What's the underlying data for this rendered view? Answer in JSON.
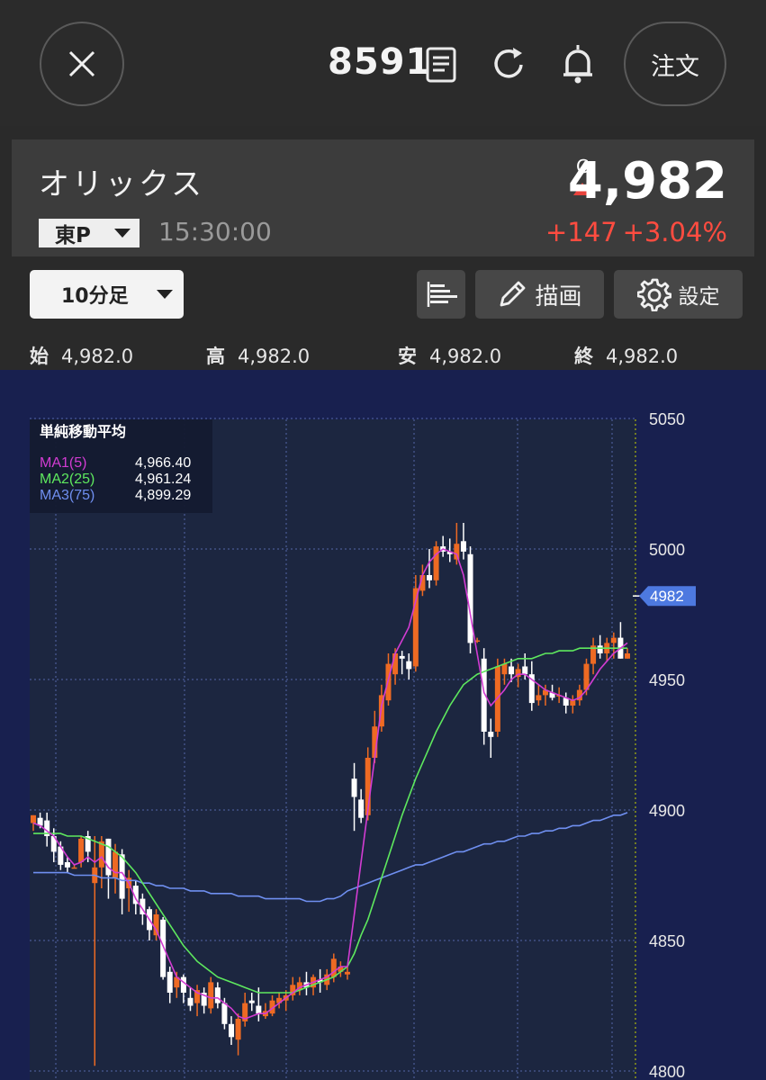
{
  "header": {
    "code": "8591",
    "order_label": "注文",
    "icons": [
      "close-icon",
      "document-icon",
      "reload-icon",
      "bell-icon"
    ]
  },
  "stock": {
    "name": "オリックス",
    "market": "東P",
    "time": "15:30:00",
    "price_flag": "C",
    "price": "4,982",
    "change": "+147",
    "change_pct": "+3.04%",
    "up_color": "#ff4c40"
  },
  "toolbar": {
    "timeframe": "10分足",
    "draw_label": "描画",
    "settings_label": "設定"
  },
  "ohlc": {
    "open_label": "始",
    "open": "4,982.0",
    "high_label": "高",
    "high": "4,982.0",
    "low_label": "安",
    "low": "4,982.0",
    "close_label": "終",
    "close": "4,982.0"
  },
  "chart_data": {
    "type": "candlestick",
    "panel_title": "単純移動平均",
    "y_ticks": [
      5050,
      5000,
      4950,
      4900,
      4850,
      4800
    ],
    "ylim": [
      4800,
      5050
    ],
    "current_price_label": "4982",
    "current_price": 4982,
    "ma_legend": [
      {
        "name": "MA1(5)",
        "value": "4,966.40",
        "color": "#d23cd2"
      },
      {
        "name": "MA2(25)",
        "value": "4,961.24",
        "color": "#5ee85e"
      },
      {
        "name": "MA3(75)",
        "value": "4,899.29",
        "color": "#6f8ff0"
      }
    ],
    "candles": [
      [
        4895,
        4898,
        4892,
        4898
      ],
      [
        4897,
        4899,
        4893,
        4894
      ],
      [
        4896,
        4899,
        4886,
        4890
      ],
      [
        4890,
        4893,
        4880,
        4884
      ],
      [
        4886,
        4888,
        4877,
        4879
      ],
      [
        4880,
        4882,
        4876,
        4878
      ],
      [
        4878,
        4879,
        4878,
        4878
      ],
      [
        4880,
        4890,
        4878,
        4889
      ],
      [
        4890,
        4892,
        4880,
        4884
      ],
      [
        4872,
        4890,
        4802,
        4878
      ],
      [
        4878,
        4890,
        4870,
        4888
      ],
      [
        4889,
        4889,
        4866,
        4875
      ],
      [
        4874,
        4887,
        4868,
        4884
      ],
      [
        4883,
        4885,
        4860,
        4866
      ],
      [
        4870,
        4877,
        4861,
        4874
      ],
      [
        4871,
        4873,
        4860,
        4864
      ],
      [
        4866,
        4868,
        4856,
        4860
      ],
      [
        4862,
        4863,
        4850,
        4854
      ],
      [
        4852,
        4862,
        4850,
        4860
      ],
      [
        4858,
        4859,
        4835,
        4836
      ],
      [
        4838,
        4840,
        4826,
        4830
      ],
      [
        4832,
        4838,
        4828,
        4836
      ],
      [
        4836,
        4837,
        4826,
        4830
      ],
      [
        4828,
        4832,
        4823,
        4825
      ],
      [
        4826,
        4833,
        4821,
        4831
      ],
      [
        4830,
        4832,
        4822,
        4825
      ],
      [
        4824,
        4836,
        4822,
        4834
      ],
      [
        4832,
        4834,
        4824,
        4826
      ],
      [
        4826,
        4828,
        4816,
        4818
      ],
      [
        4818,
        4821,
        4810,
        4813
      ],
      [
        4812,
        4822,
        4806,
        4820
      ],
      [
        4819,
        4830,
        4817,
        4826
      ],
      [
        4827,
        4830,
        4823,
        4826
      ],
      [
        4825,
        4832,
        4819,
        4822
      ],
      [
        4821,
        4826,
        4820,
        4823
      ],
      [
        4822,
        4829,
        4821,
        4827
      ],
      [
        4826,
        4830,
        4824,
        4828
      ],
      [
        4827,
        4831,
        4823,
        4829
      ],
      [
        4829,
        4836,
        4827,
        4833
      ],
      [
        4831,
        4836,
        4829,
        4834
      ],
      [
        4834,
        4838,
        4829,
        4832
      ],
      [
        4832,
        4837,
        4829,
        4836
      ],
      [
        4835,
        4839,
        4830,
        4834
      ],
      [
        4833,
        4839,
        4831,
        4837
      ],
      [
        4836,
        4845,
        4834,
        4843
      ],
      [
        4838,
        4842,
        4836,
        4840
      ],
      [
        4837,
        4840,
        4835,
        4838
      ],
      [
        4912,
        4918,
        4892,
        4905
      ],
      [
        4904,
        4908,
        4895,
        4897
      ],
      [
        4898,
        4924,
        4896,
        4920
      ],
      [
        4920,
        4938,
        4918,
        4932
      ],
      [
        4932,
        4948,
        4930,
        4944
      ],
      [
        4942,
        4960,
        4940,
        4956
      ],
      [
        4952,
        4962,
        4948,
        4960
      ],
      [
        4959,
        4961,
        4952,
        4958
      ],
      [
        4957,
        4960,
        4950,
        4954
      ],
      [
        4955,
        4990,
        4953,
        4985
      ],
      [
        4984,
        4994,
        4982,
        4990
      ],
      [
        4990,
        5000,
        4985,
        4988
      ],
      [
        4988,
        5003,
        4986,
        5001
      ],
      [
        5001,
        5005,
        4997,
        4999
      ],
      [
        4999,
        5004,
        4995,
        4998
      ],
      [
        4996,
        5010,
        4994,
        5002
      ],
      [
        5003,
        5010,
        4996,
        4999
      ],
      [
        4998,
        5001,
        4960,
        4964
      ],
      [
        4965,
        4966,
        4964,
        4965
      ],
      [
        4958,
        4962,
        4925,
        4930
      ],
      [
        4930,
        4935,
        4920,
        4928
      ],
      [
        4930,
        4958,
        4928,
        4955
      ],
      [
        4952,
        4958,
        4948,
        4956
      ],
      [
        4955,
        4958,
        4949,
        4952
      ],
      [
        4951,
        4956,
        4947,
        4954
      ],
      [
        4955,
        4960,
        4950,
        4952
      ],
      [
        4952,
        4957,
        4938,
        4941
      ],
      [
        4942,
        4948,
        4940,
        4944
      ],
      [
        4944,
        4948,
        4940,
        4946
      ],
      [
        4945,
        4948,
        4942,
        4943
      ],
      [
        4944,
        4947,
        4941,
        4944
      ],
      [
        4943,
        4945,
        4937,
        4940
      ],
      [
        4940,
        4944,
        4937,
        4942
      ],
      [
        4942,
        4948,
        4940,
        4946
      ],
      [
        4946,
        4958,
        4944,
        4956
      ],
      [
        4956,
        4966,
        4952,
        4963
      ],
      [
        4963,
        4967,
        4958,
        4960
      ],
      [
        4960,
        4966,
        4957,
        4964
      ],
      [
        4964,
        4968,
        4958,
        4966
      ],
      [
        4966,
        4972,
        4958,
        4958
      ],
      [
        4958,
        4962,
        4958,
        4960
      ]
    ],
    "ma1": [
      4895,
      4894,
      4892,
      4890,
      4886,
      4882,
      4879,
      4880,
      4882,
      4880,
      4882,
      4878,
      4876,
      4876,
      4872,
      4866,
      4862,
      4858,
      4854,
      4848,
      4842,
      4836,
      4834,
      4832,
      4830,
      4829,
      4828,
      4828,
      4826,
      4824,
      4821,
      4820,
      4821,
      4822,
      4822,
      4824,
      4826,
      4828,
      4830,
      4832,
      4833,
      4834,
      4835,
      4836,
      4838,
      4840,
      4840,
      4860,
      4880,
      4900,
      4920,
      4940,
      4950,
      4960,
      4965,
      4970,
      4980,
      4990,
      4995,
      4998,
      5000,
      4999,
      4998,
      4990,
      4975,
      4960,
      4945,
      4940,
      4943,
      4946,
      4950,
      4952,
      4952,
      4950,
      4948,
      4946,
      4945,
      4944,
      4943,
      4942,
      4943,
      4946,
      4950,
      4954,
      4957,
      4960,
      4962,
      4964
    ],
    "ma2": [
      4891,
      4891,
      4891,
      4891,
      4891,
      4890,
      4890,
      4890,
      4889,
      4888,
      4887,
      4886,
      4884,
      4882,
      4879,
      4876,
      4872,
      4868,
      4864,
      4860,
      4856,
      4852,
      4848,
      4845,
      4842,
      4840,
      4838,
      4836,
      4835,
      4834,
      4833,
      4832,
      4831,
      4830,
      4830,
      4830,
      4830,
      4830,
      4830,
      4831,
      4832,
      4833,
      4834,
      4835,
      4836,
      4838,
      4840,
      4845,
      4852,
      4858,
      4866,
      4874,
      4882,
      4890,
      4898,
      4905,
      4912,
      4918,
      4924,
      4930,
      4935,
      4940,
      4944,
      4948,
      4950,
      4952,
      4953,
      4954,
      4955,
      4956,
      4957,
      4958,
      4958,
      4958,
      4959,
      4960,
      4960,
      4961,
      4961,
      4961,
      4962,
      4962,
      4962,
      4962,
      4962,
      4962,
      4962,
      4962
    ],
    "ma3": [
      4876,
      4876,
      4876,
      4876,
      4876,
      4876,
      4875,
      4875,
      4875,
      4875,
      4874,
      4874,
      4874,
      4873,
      4873,
      4873,
      4872,
      4872,
      4871,
      4871,
      4870,
      4870,
      4870,
      4869,
      4869,
      4869,
      4868,
      4868,
      4868,
      4868,
      4867,
      4867,
      4867,
      4867,
      4866,
      4866,
      4866,
      4866,
      4866,
      4866,
      4865,
      4865,
      4865,
      4866,
      4866,
      4867,
      4869,
      4870,
      4871,
      4872,
      4873,
      4874,
      4875,
      4876,
      4877,
      4878,
      4879,
      4879,
      4880,
      4881,
      4882,
      4883,
      4884,
      4884,
      4885,
      4886,
      4887,
      4887,
      4888,
      4888,
      4889,
      4890,
      4890,
      4891,
      4891,
      4892,
      4892,
      4893,
      4893,
      4894,
      4894,
      4895,
      4896,
      4896,
      4897,
      4898,
      4898,
      4899
    ],
    "colors": {
      "up": "#ee6a23",
      "down": "#ffffff",
      "grid": "#5466a8",
      "bg": "#18204f",
      "plot_bg": "#1c2640"
    }
  }
}
